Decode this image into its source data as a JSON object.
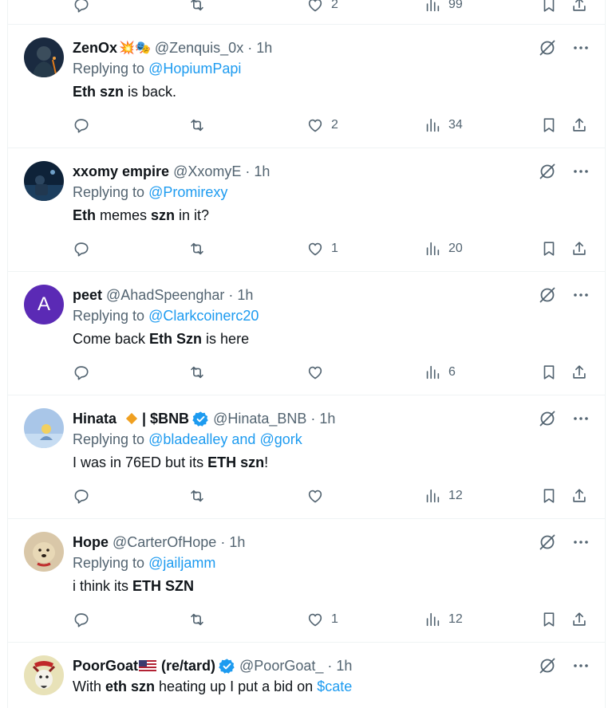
{
  "top_partial": {
    "likes": "2",
    "views": "99"
  },
  "posts": [
    {
      "name": "ZenOx",
      "emoji": "💥🎭",
      "handle": "@Zenquis_0x",
      "dot": "·",
      "time": "1h",
      "replying_prefix": "Replying to",
      "replying_to": "@HopiumPapi",
      "text_parts": [
        "Eth szn",
        " is back."
      ],
      "replies": "",
      "reposts": "",
      "likes": "2",
      "views": "34",
      "avatar_color": "#1a2a40"
    },
    {
      "name": "xxomy empire",
      "handle": "@XxomyE",
      "dot": "·",
      "time": "1h",
      "replying_prefix": "Replying to",
      "replying_to": "@Promirexy",
      "text_parts": [
        "Eth",
        " memes ",
        "szn",
        " in it?"
      ],
      "likes": "1",
      "views": "20",
      "avatar_color": "#14304a"
    },
    {
      "name": "peet",
      "handle": "@AhadSpeenghar",
      "dot": "·",
      "time": "1h",
      "replying_prefix": "Replying to",
      "replying_to": "@Clarkcoinerc20",
      "text_parts": [
        "Come back ",
        "Eth Szn",
        " is here"
      ],
      "likes": "",
      "views": "6",
      "avatar_letter": "A",
      "avatar_color": "#5b2ab5"
    },
    {
      "name": "Hinata",
      "name_suffix": "| $BNB",
      "handle": "@Hinata_BNB",
      "dot": "·",
      "time": "1h",
      "replying_prefix": "Replying to",
      "replying_to": "@bladealley and @gork",
      "text_parts": [
        "I was in 76ED but its ",
        "ETH szn",
        "!"
      ],
      "likes": "",
      "views": "12",
      "avatar_color": "#a9c6e8"
    },
    {
      "name": "Hope",
      "handle": "@CarterOfHope",
      "dot": "·",
      "time": "1h",
      "replying_prefix": "Replying to",
      "replying_to": "@jailjamm",
      "text_parts": [
        "i think its ",
        "ETH SZN"
      ],
      "likes": "1",
      "views": "12",
      "avatar_color": "#d9c7a8"
    },
    {
      "name": "PoorGoat",
      "name_suffix": "(re/tard)",
      "handle": "@PoorGoat_",
      "dot": "·",
      "time": "1h",
      "text_parts": [
        "With ",
        "eth szn",
        " heating up I put a bid on ",
        "$cate"
      ],
      "avatar_color": "#e8e2b8"
    }
  ],
  "colors": {
    "accent": "#1d9bf0",
    "muted": "#536471",
    "text": "#0f1419",
    "border": "#eff3f4"
  },
  "icons": [
    "reply-icon",
    "repost-icon",
    "like-icon",
    "views-icon",
    "bookmark-icon",
    "share-icon",
    "grok-icon",
    "more-icon",
    "verified-icon"
  ]
}
